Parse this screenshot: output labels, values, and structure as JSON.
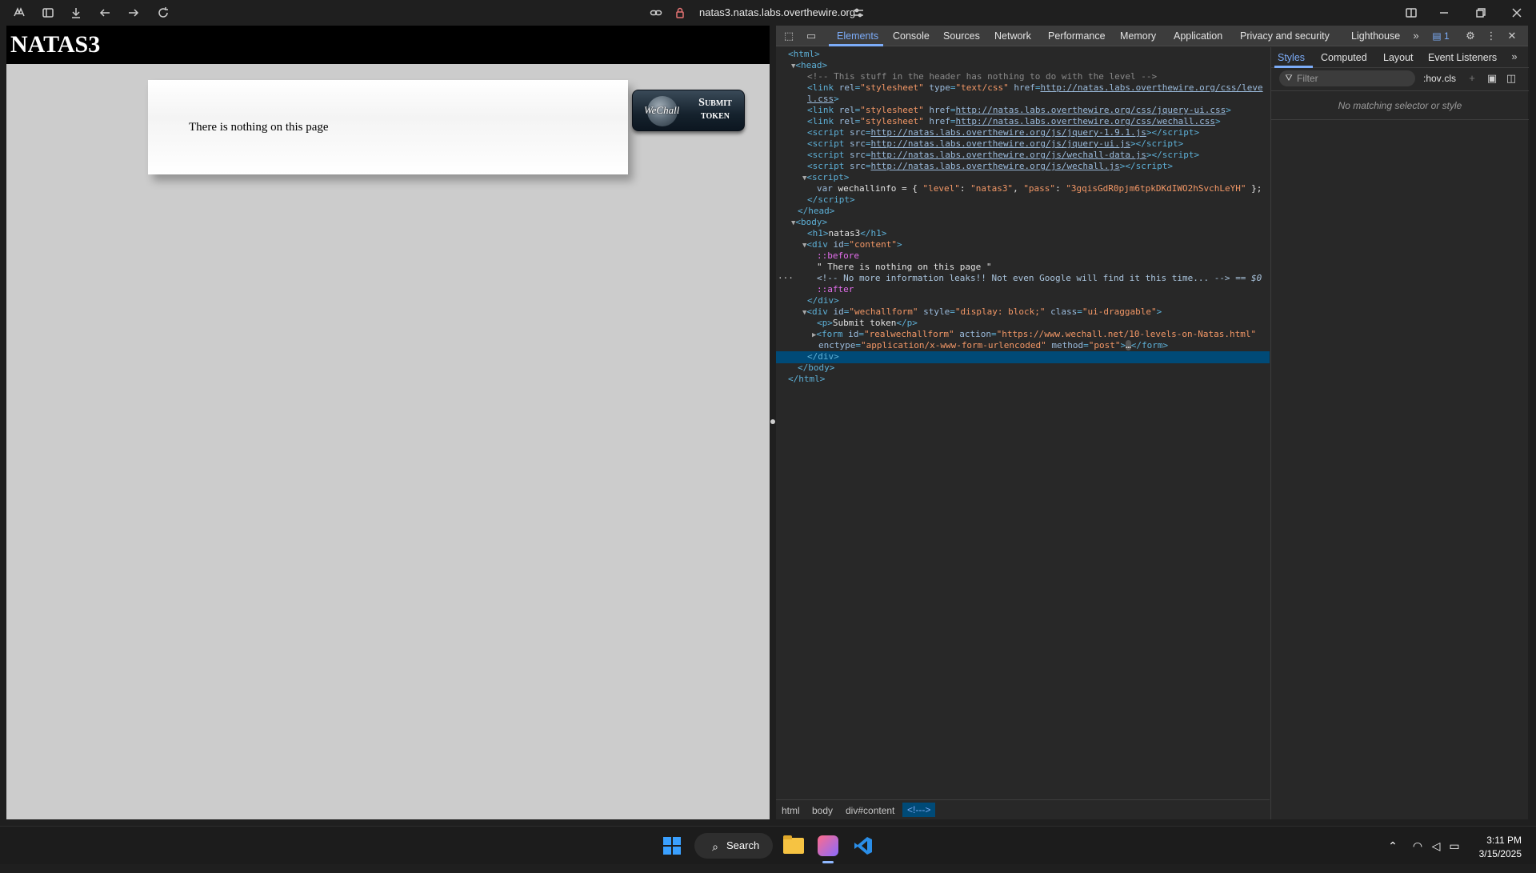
{
  "browser": {
    "url": "natas3.natas.labs.overthewire.org"
  },
  "page": {
    "title": "NATAS3",
    "content_text": "There is nothing on this page",
    "wechall": {
      "logo": "WeChall",
      "line1": "Submit",
      "line2": "token"
    }
  },
  "devtools": {
    "tabs": [
      "Elements",
      "Console",
      "Sources",
      "Network",
      "Performance",
      "Memory",
      "Application",
      "Privacy and security",
      "Lighthouse"
    ],
    "issues_count": "1",
    "source": {
      "l1": "<html>",
      "l2": "<head>",
      "l3": "<!-- This stuff in the header has nothing to do with the level -->",
      "link_level_a": "http://natas.labs.overthewire.org/css/leve",
      "link_level_b": "l.css",
      "link_jqueryui": "http://natas.labs.overthewire.org/css/jquery-ui.css",
      "link_wechall": "http://natas.labs.overthewire.org/css/wechall.css",
      "js_jquery": "http://natas.labs.overthewire.org/js/jquery-1.9.1.js",
      "js_jqueryui": "http://natas.labs.overthewire.org/js/jquery-ui.js",
      "js_wechall_data": "http://natas.labs.overthewire.org/js/wechall-data.js",
      "js_wechall": "http://natas.labs.overthewire.org/js/wechall.js",
      "wechallinfo_level": "\"natas3\"",
      "wechallinfo_pass": "\"3gqisGdR0pjm6tpkDKdIWO2hSvchLeYH\"",
      "h1_text": "natas3",
      "content_text": "\" There is nothing on this page \"",
      "hidden_comment": "<!-- No more information leaks!! Not even Google will find it this time... -->",
      "selected_marker": "== $0",
      "wechallform_style": "\"display: block;\"",
      "wechallform_class": "\"ui-draggable\"",
      "p_text": "Submit token",
      "form_action": "\"https://www.wechall.net/10-levels-on-Natas.html\"",
      "form_enctype": "\"application/x-www-form-urlencoded\"",
      "form_method": "\"post\""
    },
    "breadcrumbs": [
      "html",
      "body",
      "div#content",
      "<!--->"
    ],
    "styles_tabs": [
      "Styles",
      "Computed",
      "Layout",
      "Event Listeners"
    ],
    "filter_placeholder": "Filter",
    "hov": ":hov",
    "cls": ".cls",
    "no_match": "No matching selector or style"
  },
  "taskbar": {
    "search_label": "Search",
    "time": "3:11 PM",
    "date": "3/15/2025"
  }
}
